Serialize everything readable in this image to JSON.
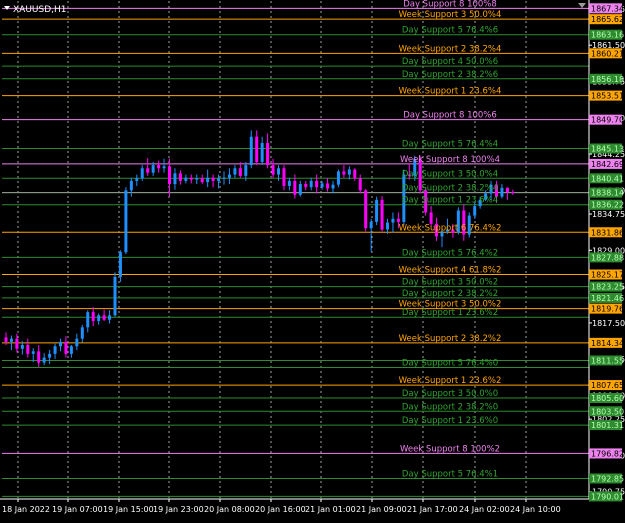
{
  "window": {
    "title": "XAUUSD,H1",
    "menu_icon": "triangle-down-icon"
  },
  "colors": {
    "background": "#000000",
    "bull": "#1e90ff",
    "bear": "#ff00ff",
    "grid": "#ffffff",
    "axis_text": "#ffffff",
    "day_line": "#2e8b2e",
    "day_text": "#2fa52f",
    "week_line": "#ffa500",
    "week_text": "#ffa500",
    "pink_line": "#ee82ee",
    "pink_text": "#ee82ee",
    "tag_text_dark": "#000000"
  },
  "chart_data": {
    "type": "candlestick",
    "symbol": "XAUUSD",
    "timeframe": "H1",
    "ylim": [
      1789.6,
      1868.5
    ],
    "grid": true,
    "y_ticks": [
      1867.25,
      1861.5,
      1855.75,
      1850.0,
      1844.25,
      1838.5,
      1834.75,
      1829.0,
      1823.25,
      1817.5,
      1811.75,
      1806.0,
      1802.25,
      1796.5,
      1790.75
    ],
    "x_labels": [
      "18 Jan 2022",
      "19 Jan 07:00",
      "19 Jan 15:00",
      "19 Jan 23:00",
      "20 Jan 08:00",
      "20 Jan 16:00",
      "21 Jan 01:00",
      "21 Jan 09:00",
      "21 Jan 17:00",
      "24 Jan 02:00",
      "24 Jan 10:00"
    ],
    "current_price": 1838.14,
    "candles": [
      [
        1815.2,
        1816.0,
        1814.0,
        1814.5
      ],
      [
        1814.5,
        1815.5,
        1813.2,
        1815.0
      ],
      [
        1815.0,
        1815.8,
        1812.8,
        1813.4
      ],
      [
        1813.4,
        1814.6,
        1812.5,
        1814.0
      ],
      [
        1814.0,
        1815.0,
        1812.0,
        1812.6
      ],
      [
        1812.6,
        1813.5,
        1811.3,
        1813.0
      ],
      [
        1813.0,
        1814.0,
        1810.5,
        1811.2
      ],
      [
        1811.2,
        1812.7,
        1810.8,
        1812.0
      ],
      [
        1812.0,
        1813.2,
        1811.0,
        1812.6
      ],
      [
        1812.6,
        1814.2,
        1811.8,
        1813.8
      ],
      [
        1813.8,
        1815.0,
        1813.0,
        1814.5
      ],
      [
        1814.5,
        1815.4,
        1812.0,
        1812.6
      ],
      [
        1812.6,
        1814.0,
        1812.0,
        1813.8
      ],
      [
        1813.8,
        1815.8,
        1813.2,
        1815.0
      ],
      [
        1815.0,
        1817.2,
        1814.4,
        1816.8
      ],
      [
        1816.8,
        1819.5,
        1816.0,
        1819.2
      ],
      [
        1819.2,
        1820.0,
        1817.0,
        1817.8
      ],
      [
        1817.8,
        1819.0,
        1817.2,
        1818.7
      ],
      [
        1818.7,
        1819.6,
        1817.8,
        1818.0
      ],
      [
        1818.0,
        1819.5,
        1817.4,
        1818.7
      ],
      [
        1818.7,
        1825.5,
        1818.5,
        1824.8
      ],
      [
        1824.8,
        1829.0,
        1824.0,
        1828.7
      ],
      [
        1828.7,
        1839.0,
        1828.4,
        1838.5
      ],
      [
        1838.5,
        1840.5,
        1837.5,
        1840.0
      ],
      [
        1840.0,
        1841.0,
        1839.2,
        1840.4
      ],
      [
        1840.4,
        1842.5,
        1840.0,
        1842.0
      ],
      [
        1842.0,
        1843.6,
        1840.8,
        1841.3
      ],
      [
        1841.3,
        1843.0,
        1840.8,
        1842.5
      ],
      [
        1842.5,
        1843.2,
        1841.3,
        1842.0
      ],
      [
        1842.0,
        1843.5,
        1841.3,
        1842.3
      ],
      [
        1842.3,
        1843.5,
        1837.5,
        1839.5
      ],
      [
        1839.5,
        1842.0,
        1838.6,
        1841.2
      ],
      [
        1841.2,
        1841.7,
        1839.4,
        1840.0
      ],
      [
        1840.0,
        1841.0,
        1839.6,
        1840.5
      ],
      [
        1840.5,
        1841.0,
        1839.6,
        1840.2
      ],
      [
        1840.2,
        1841.0,
        1839.5,
        1840.4
      ],
      [
        1840.4,
        1841.0,
        1839.5,
        1839.8
      ],
      [
        1839.8,
        1841.8,
        1839.0,
        1840.5
      ],
      [
        1840.5,
        1841.0,
        1839.0,
        1840.0
      ],
      [
        1840.0,
        1841.0,
        1838.8,
        1840.4
      ],
      [
        1840.4,
        1841.5,
        1839.4,
        1840.5
      ],
      [
        1840.5,
        1842.0,
        1839.5,
        1841.0
      ],
      [
        1841.0,
        1842.5,
        1840.5,
        1842.0
      ],
      [
        1842.0,
        1843.0,
        1840.5,
        1840.8
      ],
      [
        1840.8,
        1843.0,
        1840.0,
        1842.5
      ],
      [
        1842.5,
        1848.0,
        1842.0,
        1847.0
      ],
      [
        1847.0,
        1848.0,
        1842.5,
        1843.0
      ],
      [
        1843.0,
        1847.0,
        1842.5,
        1846.0
      ],
      [
        1846.0,
        1847.5,
        1842.0,
        1842.5
      ],
      [
        1842.5,
        1843.5,
        1840.5,
        1841.0
      ],
      [
        1841.0,
        1842.5,
        1840.0,
        1842.0
      ],
      [
        1842.0,
        1842.5,
        1838.5,
        1839.2
      ],
      [
        1839.2,
        1840.5,
        1838.5,
        1840.0
      ],
      [
        1840.0,
        1841.0,
        1837.2,
        1837.8
      ],
      [
        1837.8,
        1840.0,
        1837.5,
        1839.5
      ],
      [
        1839.5,
        1840.0,
        1838.5,
        1839.0
      ],
      [
        1839.0,
        1840.5,
        1838.5,
        1840.0
      ],
      [
        1840.0,
        1841.0,
        1838.0,
        1839.0
      ],
      [
        1839.0,
        1840.0,
        1838.6,
        1839.6
      ],
      [
        1839.6,
        1840.5,
        1838.3,
        1838.8
      ],
      [
        1838.8,
        1840.0,
        1838.0,
        1839.4
      ],
      [
        1839.4,
        1841.8,
        1839.0,
        1841.5
      ],
      [
        1841.5,
        1842.5,
        1840.5,
        1841.0
      ],
      [
        1841.0,
        1842.3,
        1840.2,
        1841.8
      ],
      [
        1841.8,
        1842.0,
        1840.0,
        1840.4
      ],
      [
        1840.4,
        1841.0,
        1838.0,
        1838.5
      ],
      [
        1838.5,
        1838.7,
        1832.0,
        1832.5
      ],
      [
        1832.5,
        1834.0,
        1828.8,
        1833.5
      ],
      [
        1833.5,
        1837.5,
        1833.0,
        1837.0
      ],
      [
        1837.0,
        1837.6,
        1832.0,
        1832.3
      ],
      [
        1832.3,
        1834.0,
        1831.6,
        1833.4
      ],
      [
        1833.4,
        1835.0,
        1831.8,
        1834.0
      ],
      [
        1834.0,
        1835.0,
        1832.5,
        1833.5
      ],
      [
        1833.5,
        1841.8,
        1833.0,
        1841.0
      ],
      [
        1841.0,
        1842.8,
        1840.2,
        1840.8
      ],
      [
        1840.8,
        1844.0,
        1840.0,
        1843.4
      ],
      [
        1843.4,
        1844.0,
        1838.0,
        1838.5
      ],
      [
        1838.5,
        1839.0,
        1834.5,
        1835.0
      ],
      [
        1835.0,
        1836.0,
        1832.8,
        1833.2
      ],
      [
        1833.2,
        1834.2,
        1830.5,
        1831.2
      ],
      [
        1831.2,
        1832.5,
        1829.5,
        1832.0
      ],
      [
        1832.0,
        1834.0,
        1831.6,
        1832.3
      ],
      [
        1832.3,
        1833.2,
        1831.0,
        1831.8
      ],
      [
        1831.8,
        1835.8,
        1831.5,
        1835.3
      ],
      [
        1835.3,
        1836.3,
        1830.5,
        1831.5
      ],
      [
        1831.5,
        1835.0,
        1831.0,
        1834.5
      ],
      [
        1834.5,
        1836.5,
        1834.0,
        1836.0
      ],
      [
        1836.0,
        1837.5,
        1835.6,
        1837.0
      ],
      [
        1837.0,
        1838.5,
        1836.8,
        1838.0
      ],
      [
        1838.0,
        1840.0,
        1837.0,
        1839.4
      ],
      [
        1839.4,
        1840.0,
        1836.5,
        1837.5
      ],
      [
        1837.5,
        1839.5,
        1837.2,
        1838.9
      ],
      [
        1838.9,
        1839.0,
        1837.0,
        1838.2
      ],
      [
        1838.2,
        1838.6,
        1837.8,
        1838.1
      ]
    ],
    "levels": [
      {
        "price": 1867.34,
        "tag": "1867.34",
        "label": "Day Support 8 100%8",
        "style": "pink"
      },
      {
        "price": 1865.62,
        "tag": "1865.62",
        "label": "Week Support 3 50.0%4",
        "style": "week"
      },
      {
        "price": 1863.16,
        "tag": "1863.16",
        "label": "Day Support 5 76.4%6",
        "style": "day"
      },
      {
        "price": 1860.21,
        "tag": "1860.21",
        "label": "Week Support 2 38.2%4",
        "style": "week"
      },
      {
        "price": 1858.19,
        "tag": "",
        "label": "Day Support 4 50.0%6",
        "style": "day"
      },
      {
        "price": 1856.18,
        "tag": "1856.18",
        "label": "Day Support 2 38.2%6",
        "style": "day"
      },
      {
        "price": 1853.51,
        "tag": "1853.51",
        "label": "Week Support 1 23.6%4",
        "style": "week"
      },
      {
        "price": 1849.7,
        "tag": "1849.70",
        "label": "Day Support 8 100%6",
        "style": "pink"
      },
      {
        "price": 1845.13,
        "tag": "1845.13",
        "label": "Day Support 5 76.4%4",
        "style": "day"
      },
      {
        "price": 1842.69,
        "tag": "1842.69",
        "label": "Week Support 8 100%4",
        "style": "pink"
      },
      {
        "price": 1840.41,
        "tag": "1840.41",
        "label": "Day Support 3 50.0%4",
        "style": "day"
      },
      {
        "price": 1838.14,
        "tag": "1838.14",
        "label": "Day Support 2 38.2%4",
        "style": "day"
      },
      {
        "price": 1836.22,
        "tag": "1836.22",
        "label": "Day Support 1 23.6%4",
        "style": "day"
      },
      {
        "price": 1831.86,
        "tag": "1831.86",
        "label": "Week Support 6 76.4%2",
        "style": "week"
      },
      {
        "price": 1827.88,
        "tag": "1827.88",
        "label": "Day Support 5 76.4%2",
        "style": "day"
      },
      {
        "price": 1825.17,
        "tag": "1825.17",
        "label": "Week Support 4 61.8%2",
        "style": "week"
      },
      {
        "price": 1823.25,
        "tag": "1823.25",
        "label": "Day Support 3 50.0%2",
        "style": "day"
      },
      {
        "price": 1821.46,
        "tag": "1821.46",
        "label": "Day Support 2 38.2%2",
        "style": "day"
      },
      {
        "price": 1819.76,
        "tag": "1819.76",
        "label": "Week Support 3 50.0%2",
        "style": "week"
      },
      {
        "price": 1818.4,
        "tag": "",
        "label": "Day Support 1 23.6%2",
        "style": "day"
      },
      {
        "price": 1814.34,
        "tag": "1814.34",
        "label": "Week Support 2 38.2%2",
        "style": "week"
      },
      {
        "price": 1811.55,
        "tag": "1811.55",
        "label": "",
        "style": "day"
      },
      {
        "price": 1810.43,
        "tag": "",
        "label": "Day Support 5 76.4%0",
        "style": "day"
      },
      {
        "price": 1807.65,
        "tag": "1807.65",
        "label": "Week Support 1 23.6%2",
        "style": "week"
      },
      {
        "price": 1805.6,
        "tag": "1805.60",
        "label": "Day Support 3 50.0%0",
        "style": "day"
      },
      {
        "price": 1803.5,
        "tag": "1803.50",
        "label": "Day Support 2 38.2%0",
        "style": "day"
      },
      {
        "price": 1801.31,
        "tag": "1801.31",
        "label": "Day Support 1 23.6%0",
        "style": "day"
      },
      {
        "price": 1796.82,
        "tag": "1796.82",
        "label": "Week Support 8 100%2",
        "style": "pink"
      },
      {
        "price": 1792.85,
        "tag": "1792.85",
        "label": "Day Support 5 76.4%1",
        "style": "day"
      },
      {
        "price": 1790.01,
        "tag": "1790.01",
        "label": "",
        "style": "day"
      }
    ]
  }
}
